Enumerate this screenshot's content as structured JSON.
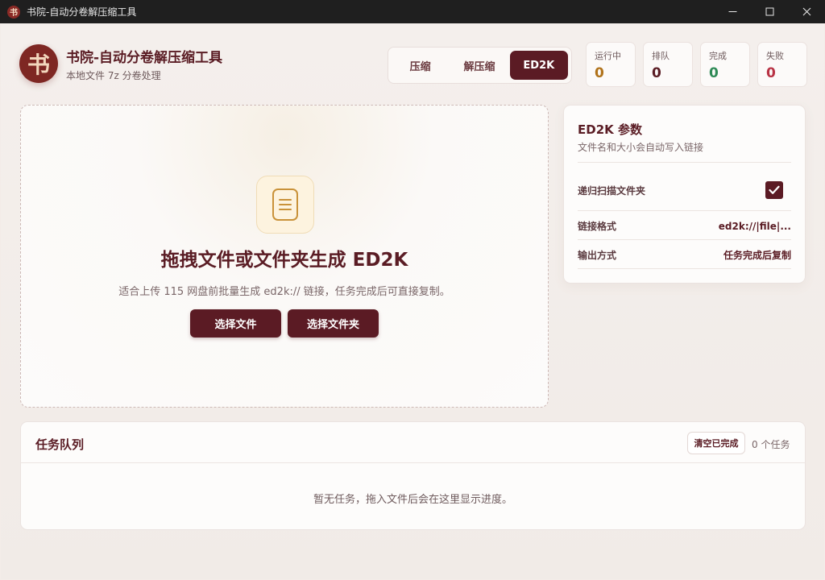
{
  "window": {
    "title": "书院-自动分卷解压缩工具",
    "app_icon_glyph": "书"
  },
  "brand": {
    "logo_glyph": "书",
    "title": "书院-自动分卷解压缩工具",
    "subtitle": "本地文件 7z 分卷处理"
  },
  "tabs": [
    {
      "label": "压缩",
      "active": false
    },
    {
      "label": "解压缩",
      "active": false
    },
    {
      "label": "ED2K",
      "active": true
    }
  ],
  "stats": [
    {
      "label": "运行中",
      "value": "0",
      "color": "#b0721a"
    },
    {
      "label": "排队",
      "value": "0",
      "color": "#5a1c24"
    },
    {
      "label": "完成",
      "value": "0",
      "color": "#2e8a56"
    },
    {
      "label": "失败",
      "value": "0",
      "color": "#b83244"
    }
  ],
  "dropzone": {
    "icon": "document-icon",
    "heading": "拖拽文件或文件夹生成 ED2K",
    "description": "适合上传 115 网盘前批量生成 ed2k:// 链接，任务完成后可直接复制。",
    "select_file_label": "选择文件",
    "select_folder_label": "选择文件夹"
  },
  "params": {
    "title": "ED2K 参数",
    "subtitle": "文件名和大小会自动写入链接",
    "recursive_label": "递归扫描文件夹",
    "recursive_checked": true,
    "link_format_label": "链接格式",
    "link_format_value": "ed2k://|file|...",
    "output_label": "输出方式",
    "output_value": "任务完成后复制"
  },
  "queue": {
    "title": "任务队列",
    "clear_label": "清空已完成",
    "count_label": "0 个任务",
    "empty_text": "暂无任务，拖入文件后会在这里显示进度。"
  },
  "colors": {
    "accent": "#5b1b24",
    "background": "#f3ece8"
  }
}
